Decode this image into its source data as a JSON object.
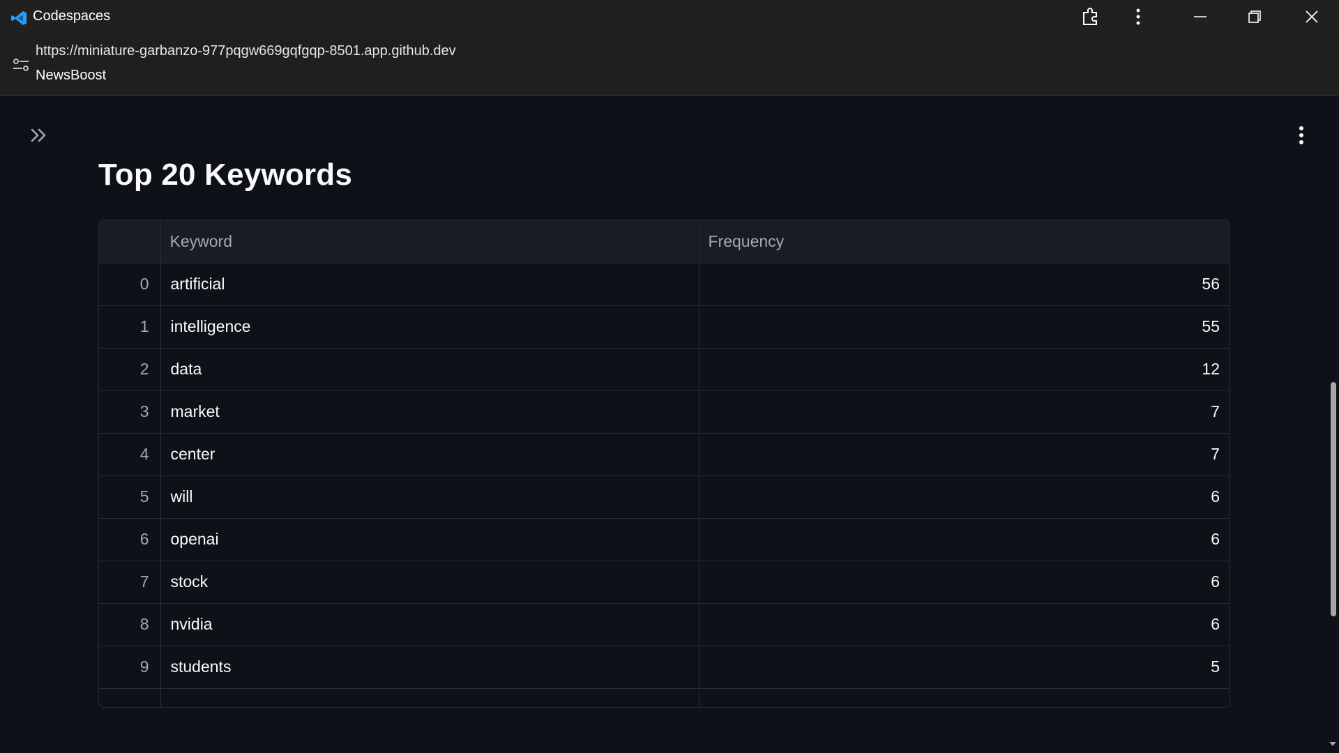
{
  "window": {
    "app_title": "Codespaces"
  },
  "address": {
    "url": "https://miniature-garbanzo-977pqgw669gqfgqp-8501.app.github.dev",
    "page_name": "NewsBoost"
  },
  "main": {
    "heading": "Top 20 Keywords",
    "table": {
      "columns": [
        "",
        "Keyword",
        "Frequency"
      ],
      "rows": [
        {
          "index": "0",
          "keyword": "artificial",
          "frequency": "56"
        },
        {
          "index": "1",
          "keyword": "intelligence",
          "frequency": "55"
        },
        {
          "index": "2",
          "keyword": "data",
          "frequency": "12"
        },
        {
          "index": "3",
          "keyword": "market",
          "frequency": "7"
        },
        {
          "index": "4",
          "keyword": "center",
          "frequency": "7"
        },
        {
          "index": "5",
          "keyword": "will",
          "frequency": "6"
        },
        {
          "index": "6",
          "keyword": "openai",
          "frequency": "6"
        },
        {
          "index": "7",
          "keyword": "stock",
          "frequency": "6"
        },
        {
          "index": "8",
          "keyword": "nvidia",
          "frequency": "6"
        },
        {
          "index": "9",
          "keyword": "students",
          "frequency": "5"
        }
      ]
    }
  },
  "icons": {
    "app_logo": "vscode-icon",
    "extensions": "extension-icon",
    "menu": "kebab-menu-icon",
    "minimize": "minimize-icon",
    "restore": "restore-icon",
    "close": "close-icon",
    "site_info": "site-settings-icon",
    "sidebar_toggle": "double-chevron-right-icon",
    "main_menu": "kebab-menu-icon"
  },
  "colors": {
    "app_background": "#0e1117",
    "titlebar": "#202020",
    "vscode_blue": "#2b9ef5",
    "table_header": "#1a1c24",
    "grid_line": "#262b36"
  }
}
